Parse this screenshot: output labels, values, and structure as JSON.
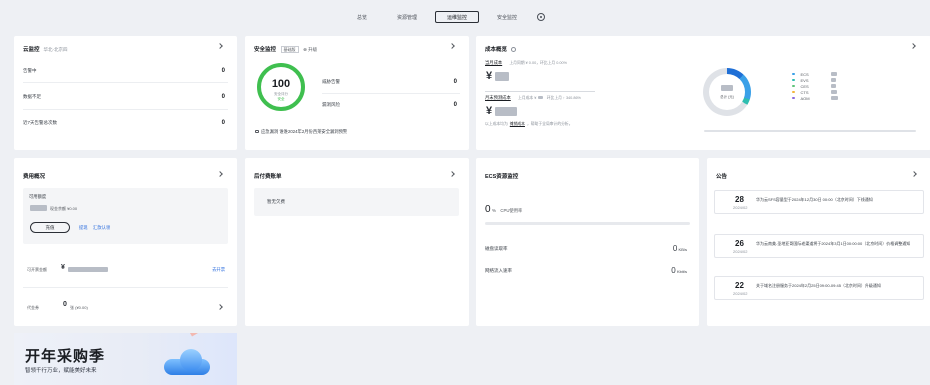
{
  "nav": {
    "tabs": [
      {
        "label": "总览"
      },
      {
        "label": "资源管理"
      },
      {
        "label": "运维监控"
      },
      {
        "label": "安全监控"
      }
    ],
    "active": "运维监控"
  },
  "cloud_monitor": {
    "title": "云监控",
    "region": "华北-北京四",
    "rows": [
      {
        "label": "告警中",
        "value": "0"
      },
      {
        "label": "数据不足",
        "value": "0"
      },
      {
        "label": "近7天告警总次数",
        "value": "0"
      }
    ]
  },
  "security": {
    "title": "安全监控",
    "edition": "基础版",
    "upgrade": "升级",
    "score": "100",
    "score_sub": "安全评分",
    "score_level": "安全",
    "rows": [
      {
        "label": "威胁告警",
        "value": "0"
      },
      {
        "label": "漏洞风险",
        "value": "0"
      }
    ],
    "footer": "应急漏洞  谁谁2024年2月份西莱安全漏洞预警"
  },
  "cost": {
    "title": "成本概览",
    "month_cost_label": "当月成本",
    "month_cost_compare": "上月同期 ¥ 0.00，环比上月 0.00%",
    "currency_symbol": "¥",
    "forecast_label": "月末预测成本",
    "forecast_compare": "上月成本 ¥",
    "forecast_trend": "环比上月 ↑ 340.86%",
    "note": "以上成本均为",
    "note_link": "摊销成本",
    "note_tail": "，帮助于全局审计的分析。",
    "donut_center": "总计 (元)",
    "legend": [
      {
        "name": "ECS",
        "color": "#3aa0e8"
      },
      {
        "name": "EVS",
        "color": "#2ebdb0"
      },
      {
        "name": "CES",
        "color": "#5fc47a"
      },
      {
        "name": "CTS",
        "color": "#f2b63c"
      },
      {
        "name": "AOM",
        "color": "#8a6be0"
      }
    ]
  },
  "fees": {
    "title": "费用概况",
    "available_label": "可用额度",
    "cash_label": "现金余额 ¥0.00",
    "recharge": "充值",
    "withdraw": "提现",
    "remit": "汇款认领",
    "quota_label": "可开票金额",
    "quota_link": "去开票",
    "voucher_label": "代金券",
    "voucher_count": "0",
    "voucher_unit": "张 (¥0.00)"
  },
  "postpaid": {
    "title": "后付费账单",
    "empty": "暂无欠费"
  },
  "ecs": {
    "title": "ECS资源监控",
    "cpu_value": "0",
    "cpu_unit": "%",
    "cpu_label": "CPU使用率",
    "rows": [
      {
        "label": "磁盘读取率",
        "value": "0",
        "unit": "KB/s"
      },
      {
        "label": "网络流入速率",
        "value": "0",
        "unit": "Kbit/s"
      }
    ]
  },
  "notices": {
    "title": "公告",
    "items": [
      {
        "day": "28",
        "ym": "2024/02",
        "text": "华为云SFS容量型于2024年12月30日 00:00（北京时间）下线通知"
      },
      {
        "day": "26",
        "ym": "2024/02",
        "text": "华为云南美-圣地亚哥国际老渠道将于2024年3月1日00:00:00（北京时间）价格调整通知"
      },
      {
        "day": "22",
        "ym": "2024/02",
        "text": "关于域名注册服务于2024年2月25日09:00-09:45（北京时间）升级通知"
      }
    ]
  },
  "banner": {
    "headline": "开年采购季",
    "tagline": "智领千行万业，赋能美好未来"
  }
}
